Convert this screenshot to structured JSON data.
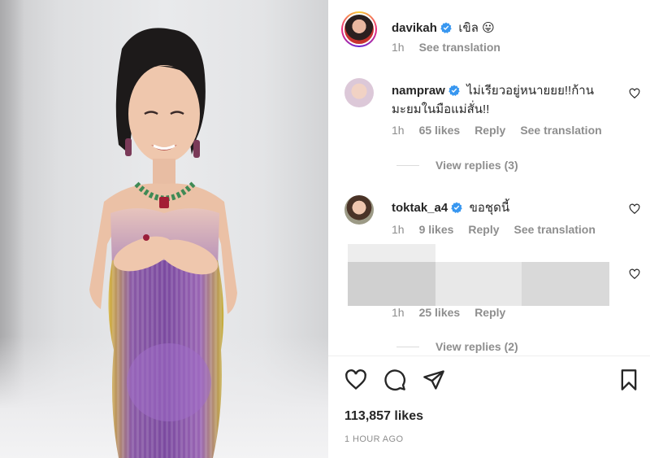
{
  "post": {
    "author": "davikah",
    "caption": "เขิล 😛",
    "time": "1h",
    "see_translation": "See translation"
  },
  "comments": [
    {
      "username": "nampraw",
      "text_line1": "ไม่เรียวอยู่หนายยย!!ก้าน",
      "text_line2": "มะยมในมือแม่สั่น!!",
      "time": "1h",
      "likes": "65 likes",
      "reply": "Reply",
      "see_translation": "See translation",
      "view_replies": "View replies (3)"
    },
    {
      "username": "toktak_a4",
      "text": "ขอชุดนี้",
      "time": "1h",
      "likes": "9 likes",
      "reply": "Reply",
      "see_translation": "See translation"
    },
    {
      "time": "1h",
      "likes": "25 likes",
      "reply": "Reply",
      "view_replies": "View replies (2)"
    }
  ],
  "footer": {
    "likes": "113,857 likes",
    "time_ago": "1 HOUR AGO"
  },
  "icons": {
    "like": "heart-icon",
    "comment": "comment-icon",
    "share": "paper-plane-icon",
    "save": "bookmark-icon",
    "verified": "verified-badge-icon"
  },
  "colors": {
    "verified": "#3897f0",
    "secondary_text": "#8e8e8e",
    "primary_text": "#262626"
  }
}
